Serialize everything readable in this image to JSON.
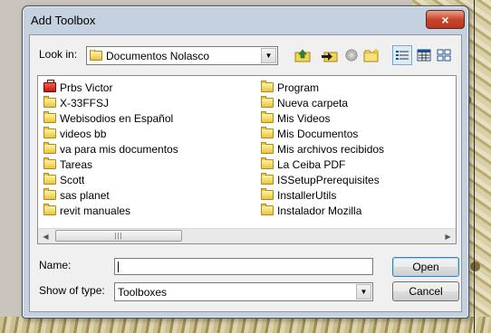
{
  "dialog": {
    "title": "Add Toolbox",
    "close_label": "×"
  },
  "look_in": {
    "label": "Look in:",
    "value": "Documentos Nolasco"
  },
  "files": {
    "left_column": [
      {
        "name": "Prbs Victor",
        "icon": "toolbox-icon"
      },
      {
        "name": "X-33FFSJ",
        "icon": "folder-icon"
      },
      {
        "name": "Webisodios en Español",
        "icon": "folder-icon"
      },
      {
        "name": "videos bb",
        "icon": "folder-icon"
      },
      {
        "name": "va para mis documentos",
        "icon": "folder-icon"
      },
      {
        "name": "Tareas",
        "icon": "folder-icon"
      },
      {
        "name": "Scott",
        "icon": "folder-icon"
      },
      {
        "name": "sas planet",
        "icon": "folder-icon"
      },
      {
        "name": "revit manuales",
        "icon": "folder-icon"
      }
    ],
    "right_column": [
      {
        "name": "Program",
        "icon": "folder-icon"
      },
      {
        "name": "Nueva carpeta",
        "icon": "folder-icon"
      },
      {
        "name": "Mis Videos",
        "icon": "folder-icon"
      },
      {
        "name": "Mis Documentos",
        "icon": "folder-icon"
      },
      {
        "name": "Mis archivos recibidos",
        "icon": "folder-icon"
      },
      {
        "name": "La Ceiba PDF",
        "icon": "folder-icon"
      },
      {
        "name": "ISSetupPrerequisites",
        "icon": "folder-icon"
      },
      {
        "name": "InstallerUtils",
        "icon": "folder-icon"
      },
      {
        "name": "Instalador Mozilla",
        "icon": "folder-icon"
      }
    ]
  },
  "form": {
    "name_label": "Name:",
    "name_value": "",
    "type_label": "Show of type:",
    "type_value": "Toolboxes"
  },
  "buttons": {
    "open": "Open",
    "cancel": "Cancel"
  }
}
